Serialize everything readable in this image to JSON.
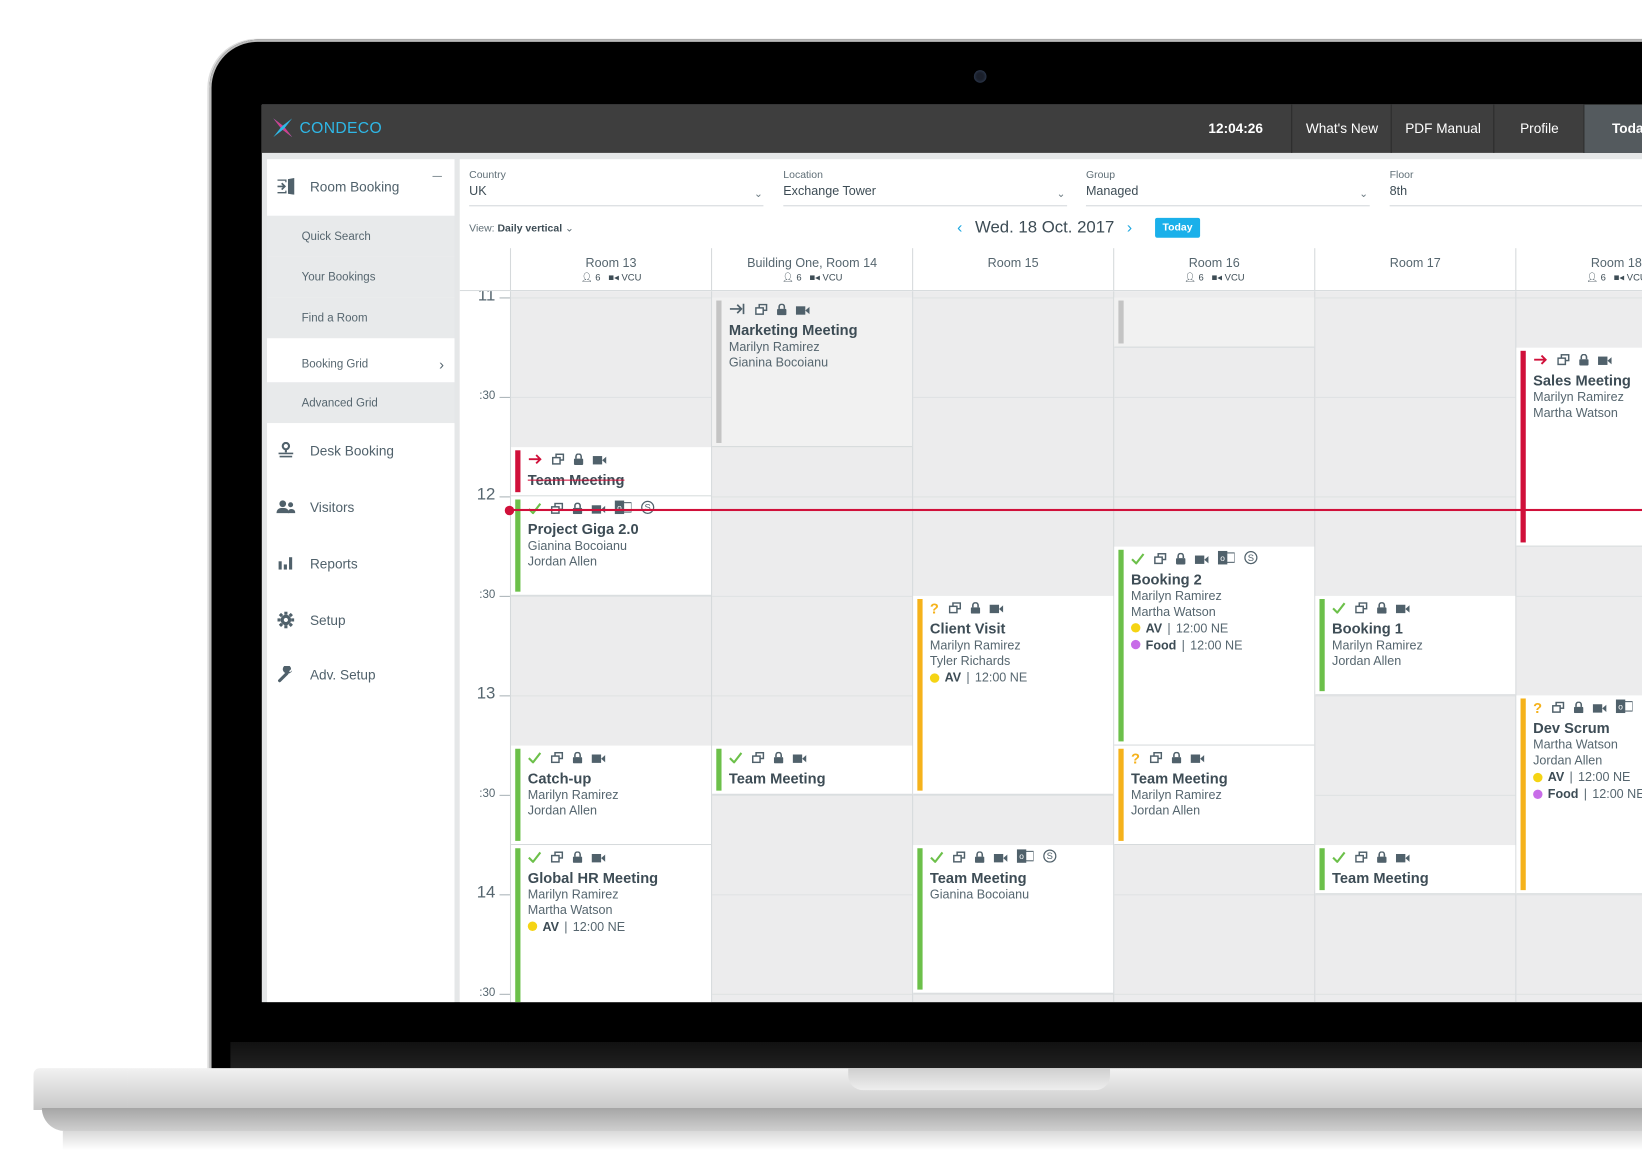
{
  "app": {
    "logo_text": "CONDECO",
    "clock": "12:04:26"
  },
  "topnav": [
    {
      "label": "What's New",
      "active": false
    },
    {
      "label": "PDF Manual",
      "active": false
    },
    {
      "label": "Profile",
      "active": false
    },
    {
      "label": "Today",
      "active": true
    }
  ],
  "sidebar": {
    "room_booking": {
      "label": "Room Booking",
      "icon": "door-enter-icon",
      "expanded": true
    },
    "sub_items": [
      {
        "label": "Quick Search",
        "active": false
      },
      {
        "label": "Your Bookings",
        "active": false
      },
      {
        "label": "Find a Room",
        "active": false
      },
      {
        "label": "Booking Grid",
        "active": true
      },
      {
        "label": "Advanced Grid",
        "active": false
      }
    ],
    "main_items": [
      {
        "label": "Desk Booking",
        "icon": "desk-location-icon"
      },
      {
        "label": "Visitors",
        "icon": "visitors-icon"
      },
      {
        "label": "Reports",
        "icon": "bar-chart-icon"
      },
      {
        "label": "Setup",
        "icon": "gear-icon"
      },
      {
        "label": "Adv. Setup",
        "icon": "wrench-icon"
      }
    ]
  },
  "filters": {
    "country": {
      "label": "Country",
      "value": "UK"
    },
    "location": {
      "label": "Location",
      "value": "Exchange Tower"
    },
    "group": {
      "label": "Group",
      "value": "Managed"
    },
    "floor": {
      "label": "Floor",
      "value": "8th"
    }
  },
  "view": {
    "label": "View:",
    "value": "Daily vertical"
  },
  "date": {
    "label": "Wed. 18 Oct. 2017",
    "today_button": "Today"
  },
  "rooms": [
    {
      "name": "Room 13",
      "capacity": "6",
      "vc": "VCU"
    },
    {
      "name": "Building One, Room 14",
      "capacity": "6",
      "vc": "VCU"
    },
    {
      "name": "Room 15",
      "capacity": "",
      "vc": ""
    },
    {
      "name": "Room 16",
      "capacity": "6",
      "vc": "VCU"
    },
    {
      "name": "Room 17",
      "capacity": "",
      "vc": ""
    },
    {
      "name": "Room 18",
      "capacity": "6",
      "vc": "VCU"
    }
  ],
  "time_labels": [
    {
      "text": "11",
      "kind": "h"
    },
    {
      "text": ":30",
      "kind": "m"
    },
    {
      "text": "12",
      "kind": "h"
    },
    {
      "text": ":30",
      "kind": "m"
    },
    {
      "text": "13",
      "kind": "h"
    },
    {
      "text": ":30",
      "kind": "m"
    },
    {
      "text": "14",
      "kind": "h"
    },
    {
      "text": ":30",
      "kind": "m"
    }
  ],
  "current_time": "12:04",
  "status_colors": {
    "confirmed": "#6cc04a",
    "tentative": "#f5b21b",
    "checkin": "#d0103a",
    "ended": "#c4c4c4"
  },
  "service_colors": {
    "AV": "#f5d414",
    "Food": "#c86de8"
  },
  "bookings": [
    {
      "room": 1,
      "start": "11:00",
      "end": "11:45",
      "status": "ended",
      "title": "Marketing Meeting",
      "people": [
        "Marilyn Ramirez",
        "Gianina Bocoianu"
      ],
      "icons": [
        "checked-out",
        "desk",
        "lock",
        "video"
      ],
      "services": []
    },
    {
      "room": 3,
      "start": "11:00",
      "end": "11:15",
      "status": "ended",
      "title": "",
      "people": [],
      "icons": [],
      "services": []
    },
    {
      "room": 5,
      "start": "11:15",
      "end": "12:15",
      "status": "checkin",
      "title": "Sales Meeting",
      "people": [
        "Marilyn Ramirez",
        "Martha Watson"
      ],
      "icons": [
        "arrow",
        "desk",
        "lock",
        "video"
      ],
      "services": []
    },
    {
      "room": 0,
      "start": "11:45",
      "end": "12:00",
      "status": "checkin",
      "title": "Team Meeting",
      "people": [],
      "icons": [
        "arrow",
        "desk",
        "lock",
        "video"
      ],
      "services": [],
      "strike": true
    },
    {
      "room": 0,
      "start": "12:00",
      "end": "12:30",
      "status": "confirmed",
      "title": "Project Giga 2.0",
      "people": [
        "Gianina Bocoianu",
        "Jordan Allen"
      ],
      "icons": [
        "check",
        "desk",
        "lock",
        "video",
        "outlook",
        "skype"
      ],
      "services": []
    },
    {
      "room": 3,
      "start": "12:15",
      "end": "13:15",
      "status": "confirmed",
      "title": "Booking 2",
      "people": [
        "Marilyn Ramirez",
        "Martha Watson"
      ],
      "icons": [
        "check",
        "desk",
        "lock",
        "video",
        "outlook",
        "skype"
      ],
      "services": [
        {
          "name": "AV",
          "time": "12:00 NE"
        },
        {
          "name": "Food",
          "time": "12:00 NE"
        }
      ]
    },
    {
      "room": 2,
      "start": "12:30",
      "end": "13:30",
      "status": "tentative",
      "title": "Client Visit",
      "people": [
        "Marilyn Ramirez",
        "Tyler Richards"
      ],
      "icons": [
        "question",
        "desk",
        "lock",
        "video"
      ],
      "services": [
        {
          "name": "AV",
          "time": "12:00 NE"
        }
      ]
    },
    {
      "room": 4,
      "start": "12:30",
      "end": "13:00",
      "status": "confirmed",
      "title": "Booking 1",
      "people": [
        "Marilyn Ramirez",
        "Jordan Allen"
      ],
      "icons": [
        "check",
        "desk",
        "lock",
        "video"
      ],
      "services": []
    },
    {
      "room": 5,
      "start": "13:00",
      "end": "14:00",
      "status": "tentative",
      "title": "Dev Scrum",
      "people": [
        "Martha Watson",
        "Jordan Allen"
      ],
      "icons": [
        "question",
        "desk",
        "lock",
        "video",
        "outlook"
      ],
      "services": [
        {
          "name": "AV",
          "time": "12:00 NE"
        },
        {
          "name": "Food",
          "time": "12:00 NE"
        }
      ]
    },
    {
      "room": 0,
      "start": "13:15",
      "end": "13:45",
      "status": "confirmed",
      "title": "Catch-up",
      "people": [
        "Marilyn Ramirez",
        "Jordan Allen"
      ],
      "icons": [
        "check",
        "desk",
        "lock",
        "video"
      ],
      "services": []
    },
    {
      "room": 1,
      "start": "13:15",
      "end": "13:30",
      "status": "confirmed",
      "title": "Team Meeting",
      "people": [],
      "icons": [
        "check",
        "desk",
        "lock",
        "video"
      ],
      "services": []
    },
    {
      "room": 3,
      "start": "13:15",
      "end": "13:45",
      "status": "tentative",
      "title": "Team Meeting",
      "people": [
        "Marilyn Ramirez",
        "Jordan Allen"
      ],
      "icons": [
        "question",
        "desk",
        "lock",
        "video"
      ],
      "services": []
    },
    {
      "room": 0,
      "start": "13:45",
      "end": "14:45",
      "status": "confirmed",
      "title": "Global HR Meeting",
      "people": [
        "Marilyn Ramirez",
        "Martha Watson"
      ],
      "icons": [
        "check",
        "desk",
        "lock",
        "video"
      ],
      "services": [
        {
          "name": "AV",
          "time": "12:00 NE"
        }
      ]
    },
    {
      "room": 2,
      "start": "13:45",
      "end": "14:30",
      "status": "confirmed",
      "title": "Team Meeting",
      "people": [
        "Gianina Bocoianu"
      ],
      "icons": [
        "check",
        "desk",
        "lock",
        "video",
        "outlook",
        "skype"
      ],
      "services": []
    },
    {
      "room": 4,
      "start": "13:45",
      "end": "14:00",
      "status": "confirmed",
      "title": "Team Meeting",
      "people": [],
      "icons": [
        "check",
        "desk",
        "lock",
        "video"
      ],
      "services": []
    }
  ]
}
